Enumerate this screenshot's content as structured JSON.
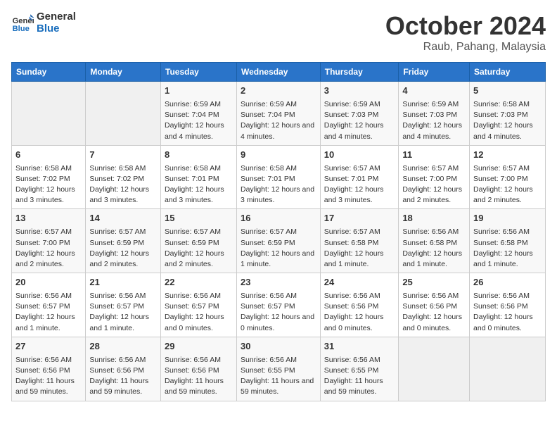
{
  "header": {
    "logo_line1": "General",
    "logo_line2": "Blue",
    "month": "October 2024",
    "location": "Raub, Pahang, Malaysia"
  },
  "days_of_week": [
    "Sunday",
    "Monday",
    "Tuesday",
    "Wednesday",
    "Thursday",
    "Friday",
    "Saturday"
  ],
  "weeks": [
    [
      {
        "day": "",
        "info": ""
      },
      {
        "day": "",
        "info": ""
      },
      {
        "day": "1",
        "info": "Sunrise: 6:59 AM\nSunset: 7:04 PM\nDaylight: 12 hours and 4 minutes."
      },
      {
        "day": "2",
        "info": "Sunrise: 6:59 AM\nSunset: 7:04 PM\nDaylight: 12 hours and 4 minutes."
      },
      {
        "day": "3",
        "info": "Sunrise: 6:59 AM\nSunset: 7:03 PM\nDaylight: 12 hours and 4 minutes."
      },
      {
        "day": "4",
        "info": "Sunrise: 6:59 AM\nSunset: 7:03 PM\nDaylight: 12 hours and 4 minutes."
      },
      {
        "day": "5",
        "info": "Sunrise: 6:58 AM\nSunset: 7:03 PM\nDaylight: 12 hours and 4 minutes."
      }
    ],
    [
      {
        "day": "6",
        "info": "Sunrise: 6:58 AM\nSunset: 7:02 PM\nDaylight: 12 hours and 3 minutes."
      },
      {
        "day": "7",
        "info": "Sunrise: 6:58 AM\nSunset: 7:02 PM\nDaylight: 12 hours and 3 minutes."
      },
      {
        "day": "8",
        "info": "Sunrise: 6:58 AM\nSunset: 7:01 PM\nDaylight: 12 hours and 3 minutes."
      },
      {
        "day": "9",
        "info": "Sunrise: 6:58 AM\nSunset: 7:01 PM\nDaylight: 12 hours and 3 minutes."
      },
      {
        "day": "10",
        "info": "Sunrise: 6:57 AM\nSunset: 7:01 PM\nDaylight: 12 hours and 3 minutes."
      },
      {
        "day": "11",
        "info": "Sunrise: 6:57 AM\nSunset: 7:00 PM\nDaylight: 12 hours and 2 minutes."
      },
      {
        "day": "12",
        "info": "Sunrise: 6:57 AM\nSunset: 7:00 PM\nDaylight: 12 hours and 2 minutes."
      }
    ],
    [
      {
        "day": "13",
        "info": "Sunrise: 6:57 AM\nSunset: 7:00 PM\nDaylight: 12 hours and 2 minutes."
      },
      {
        "day": "14",
        "info": "Sunrise: 6:57 AM\nSunset: 6:59 PM\nDaylight: 12 hours and 2 minutes."
      },
      {
        "day": "15",
        "info": "Sunrise: 6:57 AM\nSunset: 6:59 PM\nDaylight: 12 hours and 2 minutes."
      },
      {
        "day": "16",
        "info": "Sunrise: 6:57 AM\nSunset: 6:59 PM\nDaylight: 12 hours and 1 minute."
      },
      {
        "day": "17",
        "info": "Sunrise: 6:57 AM\nSunset: 6:58 PM\nDaylight: 12 hours and 1 minute."
      },
      {
        "day": "18",
        "info": "Sunrise: 6:56 AM\nSunset: 6:58 PM\nDaylight: 12 hours and 1 minute."
      },
      {
        "day": "19",
        "info": "Sunrise: 6:56 AM\nSunset: 6:58 PM\nDaylight: 12 hours and 1 minute."
      }
    ],
    [
      {
        "day": "20",
        "info": "Sunrise: 6:56 AM\nSunset: 6:57 PM\nDaylight: 12 hours and 1 minute."
      },
      {
        "day": "21",
        "info": "Sunrise: 6:56 AM\nSunset: 6:57 PM\nDaylight: 12 hours and 1 minute."
      },
      {
        "day": "22",
        "info": "Sunrise: 6:56 AM\nSunset: 6:57 PM\nDaylight: 12 hours and 0 minutes."
      },
      {
        "day": "23",
        "info": "Sunrise: 6:56 AM\nSunset: 6:57 PM\nDaylight: 12 hours and 0 minutes."
      },
      {
        "day": "24",
        "info": "Sunrise: 6:56 AM\nSunset: 6:56 PM\nDaylight: 12 hours and 0 minutes."
      },
      {
        "day": "25",
        "info": "Sunrise: 6:56 AM\nSunset: 6:56 PM\nDaylight: 12 hours and 0 minutes."
      },
      {
        "day": "26",
        "info": "Sunrise: 6:56 AM\nSunset: 6:56 PM\nDaylight: 12 hours and 0 minutes."
      }
    ],
    [
      {
        "day": "27",
        "info": "Sunrise: 6:56 AM\nSunset: 6:56 PM\nDaylight: 11 hours and 59 minutes."
      },
      {
        "day": "28",
        "info": "Sunrise: 6:56 AM\nSunset: 6:56 PM\nDaylight: 11 hours and 59 minutes."
      },
      {
        "day": "29",
        "info": "Sunrise: 6:56 AM\nSunset: 6:56 PM\nDaylight: 11 hours and 59 minutes."
      },
      {
        "day": "30",
        "info": "Sunrise: 6:56 AM\nSunset: 6:55 PM\nDaylight: 11 hours and 59 minutes."
      },
      {
        "day": "31",
        "info": "Sunrise: 6:56 AM\nSunset: 6:55 PM\nDaylight: 11 hours and 59 minutes."
      },
      {
        "day": "",
        "info": ""
      },
      {
        "day": "",
        "info": ""
      }
    ]
  ]
}
